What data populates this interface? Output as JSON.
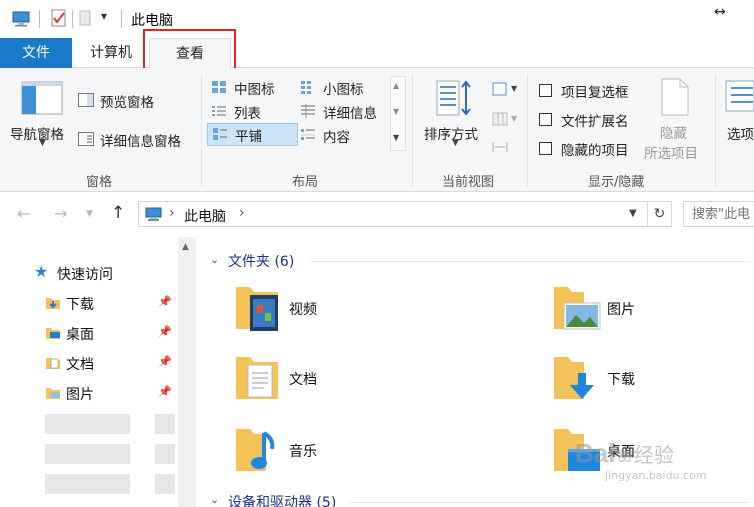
{
  "window": {
    "title": "此电脑",
    "qat_dropdown": "▾",
    "resize_glyph": "↔"
  },
  "tabs": {
    "file": "文件",
    "computer": "计算机",
    "view": "查看"
  },
  "ribbon": {
    "panes": {
      "label": "窗格",
      "nav_pane": "导航窗格",
      "preview_pane": "预览窗格",
      "details_pane": "详细信息窗格"
    },
    "layout": {
      "label": "布局",
      "medium_icons": "中图标",
      "small_icons": "小图标",
      "list": "列表",
      "details": "详细信息",
      "tiles": "平铺",
      "content": "内容"
    },
    "current_view": {
      "label": "当前视图",
      "sort_by": "排序方式"
    },
    "show_hide": {
      "label": "显示/隐藏",
      "item_checkboxes": "项目复选框",
      "file_extensions": "文件扩展名",
      "hidden_items": "隐藏的项目",
      "hide_selected_line1": "隐藏",
      "hide_selected_line2": "所选项目"
    },
    "options_truncated": "选项"
  },
  "address": {
    "separator": "›",
    "location": "此电脑",
    "search_placeholder": "搜索\"此电"
  },
  "nav_pane": {
    "quick_access": "快速访问",
    "items": [
      {
        "label": "下载",
        "icon": "download-folder-icon"
      },
      {
        "label": "桌面",
        "icon": "desktop-folder-icon"
      },
      {
        "label": "文档",
        "icon": "documents-folder-icon"
      },
      {
        "label": "图片",
        "icon": "pictures-folder-icon"
      }
    ]
  },
  "content": {
    "folders_header": "文件夹 (6)",
    "folders": [
      {
        "label": "视频",
        "icon": "videos-folder-icon"
      },
      {
        "label": "图片",
        "icon": "pictures-folder-icon"
      },
      {
        "label": "文档",
        "icon": "documents-folder-icon"
      },
      {
        "label": "下载",
        "icon": "downloads-folder-icon"
      },
      {
        "label": "音乐",
        "icon": "music-folder-icon"
      },
      {
        "label": "桌面",
        "icon": "desktop-folder-icon"
      }
    ],
    "drives_header": "设备和驱动器 (5)"
  },
  "watermark": {
    "brand": "Bai",
    "brand2": "经验",
    "url": "jingyan.baidu.com"
  },
  "colors": {
    "file_tab": "#1979ca",
    "highlight": "#e02424",
    "section_header": "#1e3287",
    "folder": "#f3c35a"
  }
}
